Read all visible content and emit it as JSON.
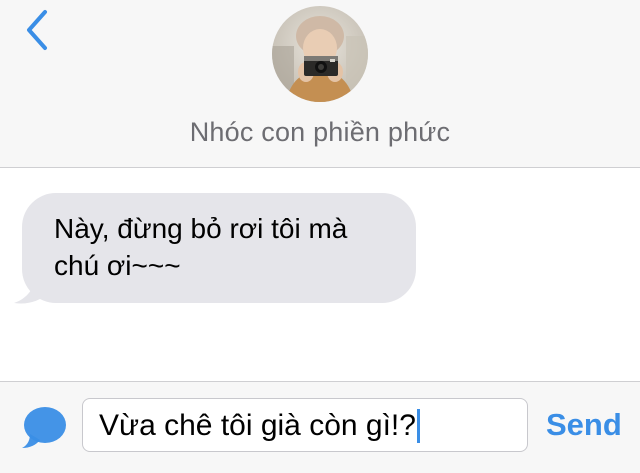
{
  "header": {
    "contact_name": "Nhóc con phiền phức"
  },
  "thread": {
    "messages": [
      {
        "direction": "incoming",
        "lines": [
          "Này, đừng bỏ rơi tôi mà",
          "chú ơi~~~"
        ]
      }
    ]
  },
  "composer": {
    "input_value": "Vừa chê tôi già còn gì!?",
    "send_label": "Send"
  },
  "icons": {
    "back": "chevron-left-icon",
    "compose": "message-bubble-icon"
  },
  "colors": {
    "accent": "#3a8ee6",
    "incoming_bubble": "#e5e5ea",
    "header_bg": "#f7f7f7",
    "contact_name": "#6d6d72"
  }
}
